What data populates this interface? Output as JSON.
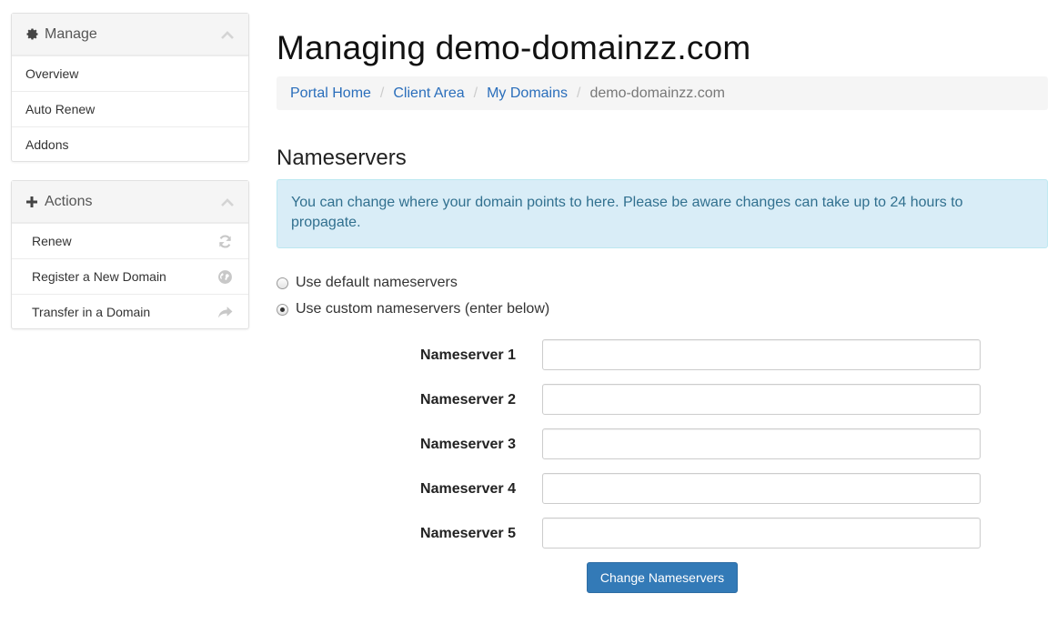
{
  "sidebar": {
    "manage": {
      "title": "Manage",
      "icon": "gear-icon",
      "items": [
        {
          "label": "Overview"
        },
        {
          "label": "Auto Renew"
        },
        {
          "label": "Addons"
        }
      ]
    },
    "actions": {
      "title": "Actions",
      "icon": "plus-icon",
      "items": [
        {
          "label": "Renew",
          "icon": "refresh-icon"
        },
        {
          "label": "Register a New Domain",
          "icon": "globe-icon"
        },
        {
          "label": "Transfer in a Domain",
          "icon": "share-arrow-icon"
        }
      ]
    }
  },
  "main": {
    "title": "Managing demo-domainzz.com",
    "breadcrumb": [
      {
        "label": "Portal Home"
      },
      {
        "label": "Client Area"
      },
      {
        "label": "My Domains"
      },
      {
        "label": "demo-domainzz.com"
      }
    ],
    "section_title": "Nameservers",
    "info_text": "You can change where your domain points to here. Please be aware changes can take up to 24 hours to propagate.",
    "radio_options": [
      {
        "label": "Use default nameservers",
        "checked": false
      },
      {
        "label": "Use custom nameservers (enter below)",
        "checked": true
      }
    ],
    "nameservers": [
      {
        "label": "Nameserver 1",
        "value": ""
      },
      {
        "label": "Nameserver 2",
        "value": ""
      },
      {
        "label": "Nameserver 3",
        "value": ""
      },
      {
        "label": "Nameserver 4",
        "value": ""
      },
      {
        "label": "Nameserver 5",
        "value": ""
      }
    ],
    "submit_label": "Change Nameservers"
  },
  "colors": {
    "link": "#2a6ebb",
    "info_bg": "#d9edf7",
    "info_text": "#31708f",
    "button": "#337ab7"
  }
}
